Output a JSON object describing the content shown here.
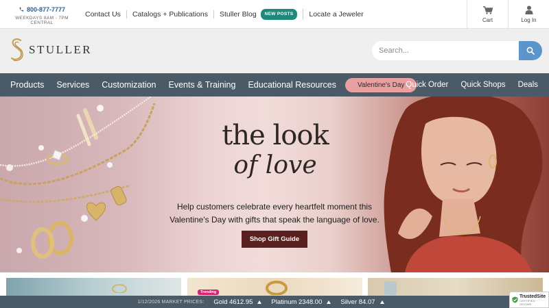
{
  "utility": {
    "phone": "800-877-7777",
    "hours": "WEEKDAYS 8AM - 7PM CENTRAL",
    "links": [
      {
        "label": "Contact Us"
      },
      {
        "label": "Catalogs + Publications"
      },
      {
        "label": "Stuller Blog",
        "badge": "NEW POSTS"
      },
      {
        "label": "Locate a Jeweler"
      }
    ],
    "cart_label": "Cart",
    "login_label": "Log In"
  },
  "brand": {
    "name": "STULLER",
    "logo_color": "#c9a15a"
  },
  "search": {
    "placeholder": "Search..."
  },
  "nav": {
    "items": [
      "Products",
      "Services",
      "Customization",
      "Events & Training",
      "Educational Resources"
    ],
    "highlight": "Valentine's Day",
    "right_items": [
      "Quick Order",
      "Quick Shops",
      "Deals"
    ]
  },
  "hero": {
    "headline_1": "the look",
    "headline_2": "of love",
    "subtext": "Help customers celebrate every heartfelt moment this Valentine's Day with gifts that speak the language of love.",
    "cta": "Shop Gift Guide"
  },
  "tiles": {
    "trending_badge": "Trending"
  },
  "market": {
    "date_label": "1/12/2026 MARKET PRICES:",
    "gold": "Gold 4612.95",
    "platinum": "Platinum 2348.00",
    "silver": "Silver 84.07"
  },
  "trust": {
    "title": "TrustedSite",
    "subtitle": "CERTIFIED SECURE"
  },
  "colors": {
    "nav_bg": "#4a5a66",
    "accent_blue": "#5b95c9",
    "cta_bg": "#5a1f1f",
    "valentine_pill": "#e8a0a0",
    "new_badge": "#1f8a7a"
  }
}
